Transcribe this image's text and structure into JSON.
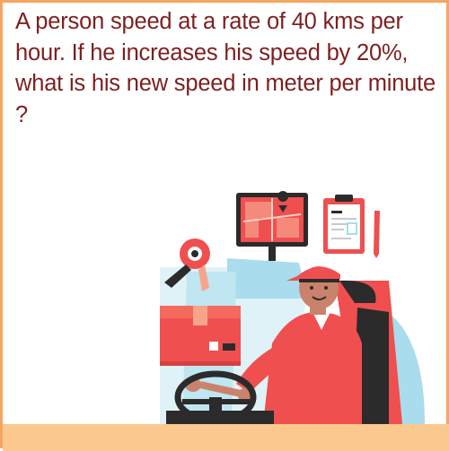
{
  "question": {
    "text": "A person speed at a rate of 40 kms per hour. If he increases his speed by 20%, what is his new speed in meter per minute ?"
  },
  "colors": {
    "text": "#7d1f1f",
    "border": "#f6a561",
    "bottom_bar": "#fbc98e",
    "accent_red": "#ef4f4f",
    "accent_blue": "#a9dcec",
    "dark": "#2b2b2b"
  },
  "illustration": {
    "subject": "delivery-driver-illustration",
    "icons": [
      "gps-map-icon",
      "clipboard-icon",
      "tape-dispenser-icon",
      "package-box-icon",
      "steering-wheel-icon"
    ]
  }
}
